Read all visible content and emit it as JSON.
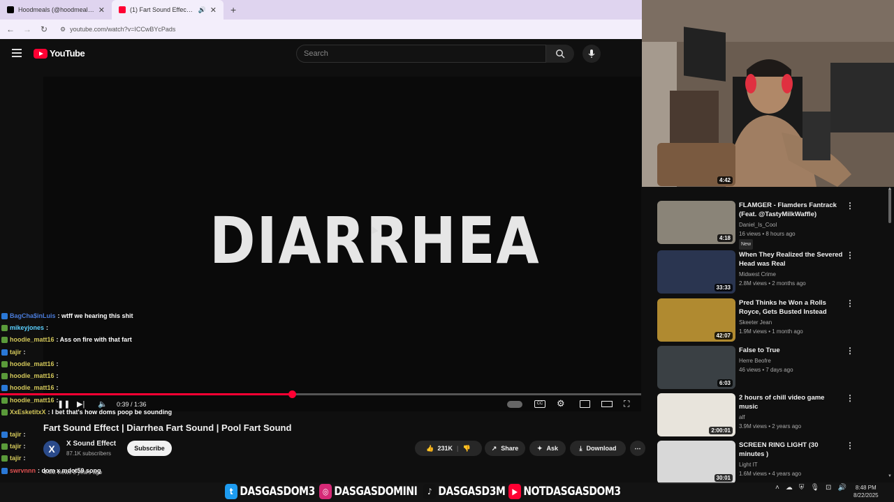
{
  "browser": {
    "tabs": [
      {
        "title": "Hoodmeals (@hoodmeals) | Tik",
        "color": "#000000"
      },
      {
        "title": "(1) Fart Sound Effect | Diarr",
        "color": "#ff0033"
      }
    ],
    "url": "youtube.com/watch?v=ICCwBYcPads"
  },
  "youtube": {
    "logo_text": "YouTube",
    "search_placeholder": "Search"
  },
  "video": {
    "overlay_text": "DIARRHEA",
    "progress": 0.455,
    "time": "0:39 / 1:36",
    "title": "Fart Sound Effect | Diarrhea Fart Sound | Pool Fart Sound",
    "channel": "X Sound Effect",
    "channel_initial": "X",
    "subscribers": "87.1K subscribers",
    "subscribe_label": "Subscribe",
    "likes": "231K",
    "share_label": "Share",
    "ask_label": "Ask",
    "download_label": "Download",
    "views_line": "4.4M views  3 years ago"
  },
  "chat": [
    {
      "user": "BagCha$inLuis",
      "msg": ": wtff we hearing this shit",
      "color": "#4a7bd9"
    },
    {
      "user": "mikeyjones",
      "msg": ":",
      "color": "#5ad0ff"
    },
    {
      "user": "hoodie_matt16",
      "msg": ": Ass on fire with that fart",
      "color": "#d4c85a"
    },
    {
      "user": "tajir",
      "msg": ":",
      "color": "#d4c85a"
    },
    {
      "user": "hoodie_matt16",
      "msg": ":",
      "color": "#d4c85a"
    },
    {
      "user": "hoodie_matt16",
      "msg": ":",
      "color": "#d4c85a"
    },
    {
      "user": "hoodie_matt16",
      "msg": ":",
      "color": "#d4c85a"
    },
    {
      "user": "hoodie_matt16",
      "msg": ":",
      "color": "#d4c85a"
    },
    {
      "user": "XxEsketitxX",
      "msg": ": I bet that's how doms poop be sounding",
      "color": "#d4c85a"
    },
    {
      "user": "tajir",
      "msg": ":",
      "color": "#d4c85a"
    },
    {
      "user": "tajir",
      "msg": ":",
      "color": "#d4c85a"
    },
    {
      "user": "tajir",
      "msg": ":",
      "color": "#d4c85a"
    },
    {
      "user": "swrvnnn",
      "msg": ": dom x mdot59 song",
      "color": "#e05050"
    }
  ],
  "recommendations": [
    {
      "title": "",
      "channel": "",
      "meta": "",
      "duration": "4:42",
      "thumb_color": "#7a5a40"
    },
    {
      "title": "FLAMGER - Flamders Fantrack (Feat. @TastyMilkWaffle)",
      "channel": "Daniel_Is_Cool",
      "meta": "16 views • 8 hours ago",
      "badge": "New",
      "duration": "4:18",
      "thumb_color": "#8a8478"
    },
    {
      "title": "When They Realized the Severed Head was Real",
      "channel": "Midwest Crime",
      "meta": "2.8M views • 2 months ago",
      "duration": "33:33",
      "thumb_color": "#2a3550"
    },
    {
      "title": "Pred Thinks he Won a Rolls Royce, Gets Busted Instead",
      "channel": "Skeeter Jean",
      "meta": "1.9M views • 1 month ago",
      "duration": "42:07",
      "thumb_color": "#b08a30"
    },
    {
      "title": "False to True",
      "channel": "Herre Beofre",
      "meta": "46 views • 7 days ago",
      "duration": "6:03",
      "thumb_color": "#3a4044"
    },
    {
      "title": "2 hours of chill video game music",
      "channel": "alf",
      "meta": "3.9M views • 2 years ago",
      "duration": "2:00:01",
      "thumb_color": "#e8e4dc"
    },
    {
      "title": "SCREEN RING LIGHT (30 minutes )",
      "channel": "Light IT",
      "meta": "1.6M views • 4 years ago",
      "duration": "30:01",
      "thumb_color": "#d8d8d8"
    }
  ],
  "socials": [
    {
      "handle": "DASGASDOM3",
      "icon": "twitter-icon",
      "color": "#1d9bf0",
      "glyph": "t"
    },
    {
      "handle": "DASGASDOMINI",
      "icon": "instagram-icon",
      "color": "#d62976",
      "glyph": "◎"
    },
    {
      "handle": "DASGASD3M",
      "icon": "tiktok-icon",
      "color": "#111111",
      "glyph": "♪"
    },
    {
      "handle": "NOTDASGASDOM3",
      "icon": "kick-icon",
      "color": "#53fc18",
      "glyph": "K"
    },
    {
      "handle": "",
      "icon": "youtube-icon",
      "color": "#ff0033",
      "glyph": "▶"
    }
  ],
  "taskbar": {
    "time": "8:48 PM",
    "date": "8/22/2025"
  }
}
